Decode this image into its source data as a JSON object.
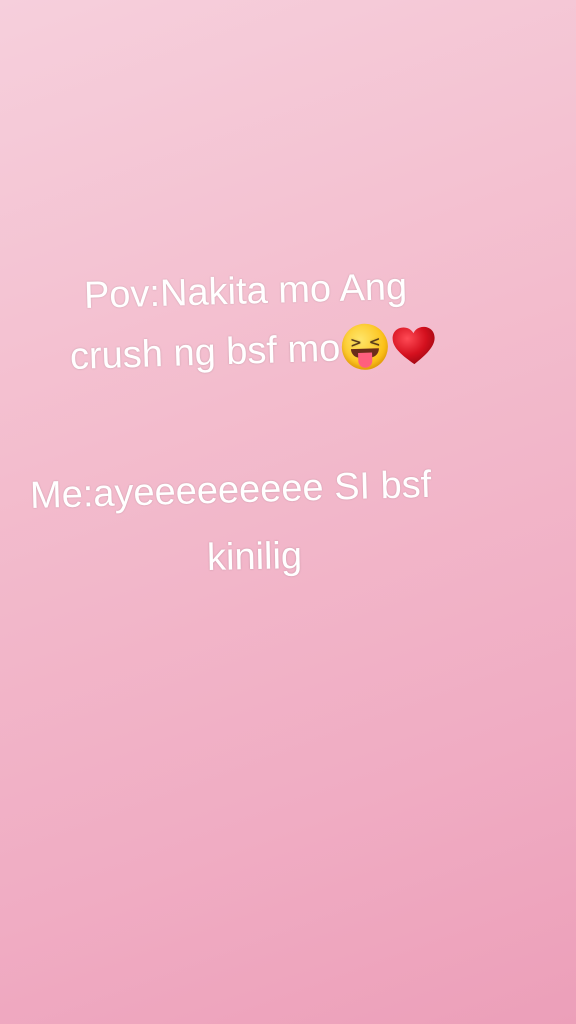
{
  "story": {
    "pov_line1": "Pov:Nakita  mo Ang",
    "pov_line2": "crush ng bsf mo",
    "me_line1": "Me:ayeeeeeeeee SI bsf",
    "me_line2": "kinilig"
  },
  "icons": {
    "emoji_1": "squinting-face-with-tongue-icon",
    "emoji_2": "red-heart-icon"
  },
  "colors": {
    "background_top": "#f6cfdc",
    "background_bottom": "#ec9fb9",
    "text": "#ffffff",
    "heart": "#d4101e"
  }
}
